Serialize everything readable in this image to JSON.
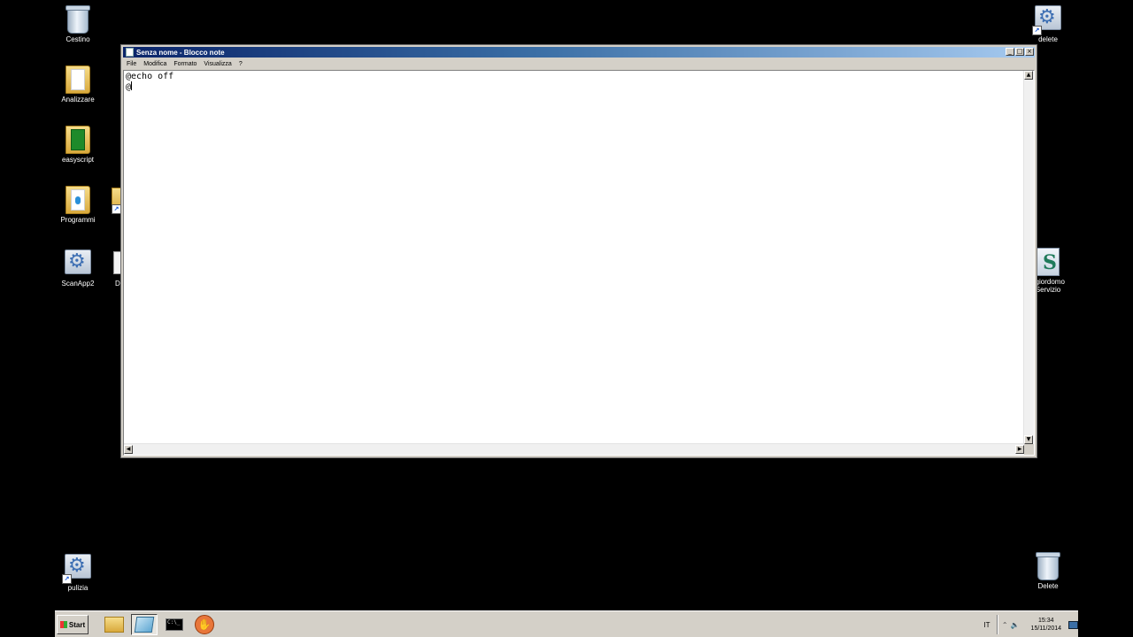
{
  "desktop": {
    "icons_left": [
      {
        "label": "Cestino"
      },
      {
        "label": "Analizzare"
      },
      {
        "label": "easyscript"
      },
      {
        "label": "Programmi"
      },
      {
        "label": "ScanApp2"
      },
      {
        "label": "pulizia"
      }
    ],
    "icons_partial": [
      {
        "label": "D"
      }
    ],
    "icons_right": [
      {
        "label": "delete"
      },
      {
        "label": "ggiordomo"
      },
      {
        "label": "Servizio"
      },
      {
        "label": "Delete"
      }
    ]
  },
  "window": {
    "title": "Senza nome - Blocco note",
    "controls": {
      "minimize": "_",
      "maximize": "□",
      "close": "×"
    },
    "menu": [
      "File",
      "Modifica",
      "Formato",
      "Visualizza",
      "?"
    ],
    "content_lines": [
      "@echo off",
      "@"
    ]
  },
  "taskbar": {
    "start_label": "Start",
    "quicklaunch": [
      {
        "icon": "folder-icon"
      },
      {
        "icon": "notepad-icon",
        "active": true
      },
      {
        "icon": "cmd-icon"
      },
      {
        "icon": "hand-app-icon"
      }
    ],
    "language": "IT",
    "time": "15:34",
    "date": "15/11/2014"
  }
}
